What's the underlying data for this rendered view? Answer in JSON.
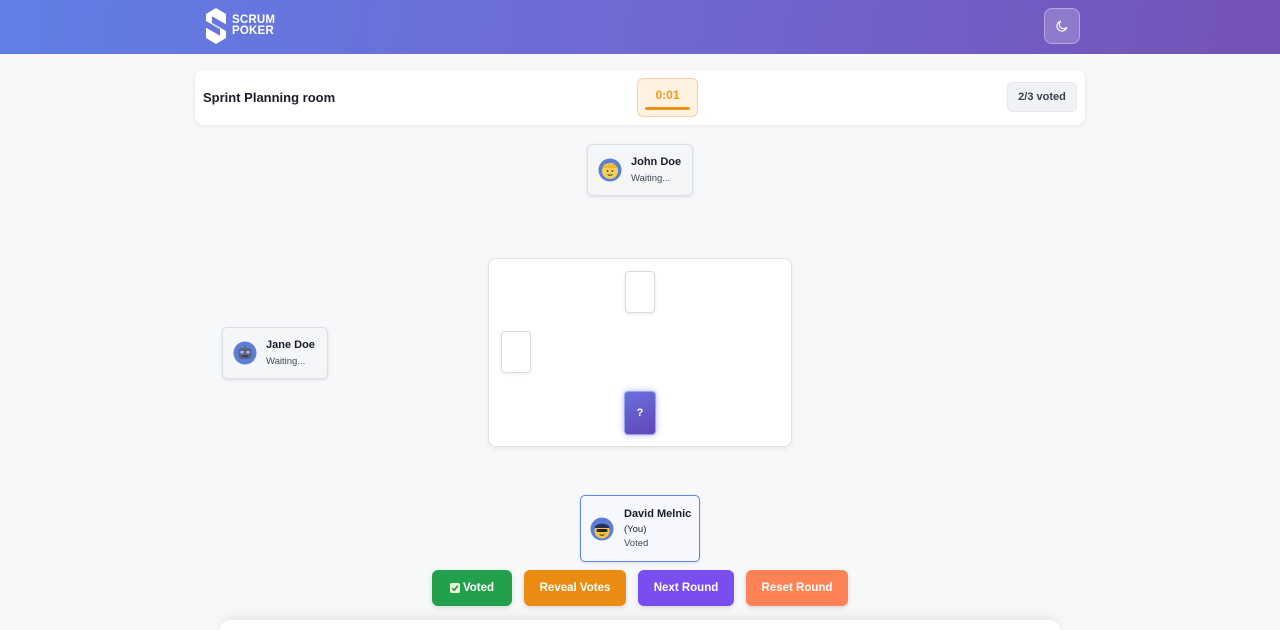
{
  "header": {
    "logo_line1": "SCRUM",
    "logo_line2": "POKER",
    "theme_toggle_icon": "moon-icon"
  },
  "room": {
    "title": "Sprint Planning room",
    "timer": "0:01",
    "timer_progress": 1.0,
    "voted_count": "2/3 voted"
  },
  "players": [
    {
      "name": "John Doe",
      "status": "Waiting...",
      "avatar": "blonde-boy-avatar"
    },
    {
      "name": "Jane Doe",
      "status": "Waiting...",
      "avatar": "robot-avatar"
    },
    {
      "name": "David Melnic",
      "you_label": "(You)",
      "status": "Voted",
      "avatar": "police-avatar"
    }
  ],
  "table": {
    "hidden_card_label": "?"
  },
  "actions": {
    "voted_label": "Voted",
    "reveal_label": "Reveal Votes",
    "next_label": "Next Round",
    "reset_label": "Reset Round"
  },
  "colors": {
    "header_gradient_start": "#5f7fe6",
    "header_gradient_end": "#7452b6",
    "timer_accent": "#f09a1e",
    "voted_button": "#22a04b",
    "reveal_button": "#ea8c12",
    "next_button": "#7a4df0",
    "reset_button": "#ff8255",
    "you_border": "#5d86e8"
  }
}
